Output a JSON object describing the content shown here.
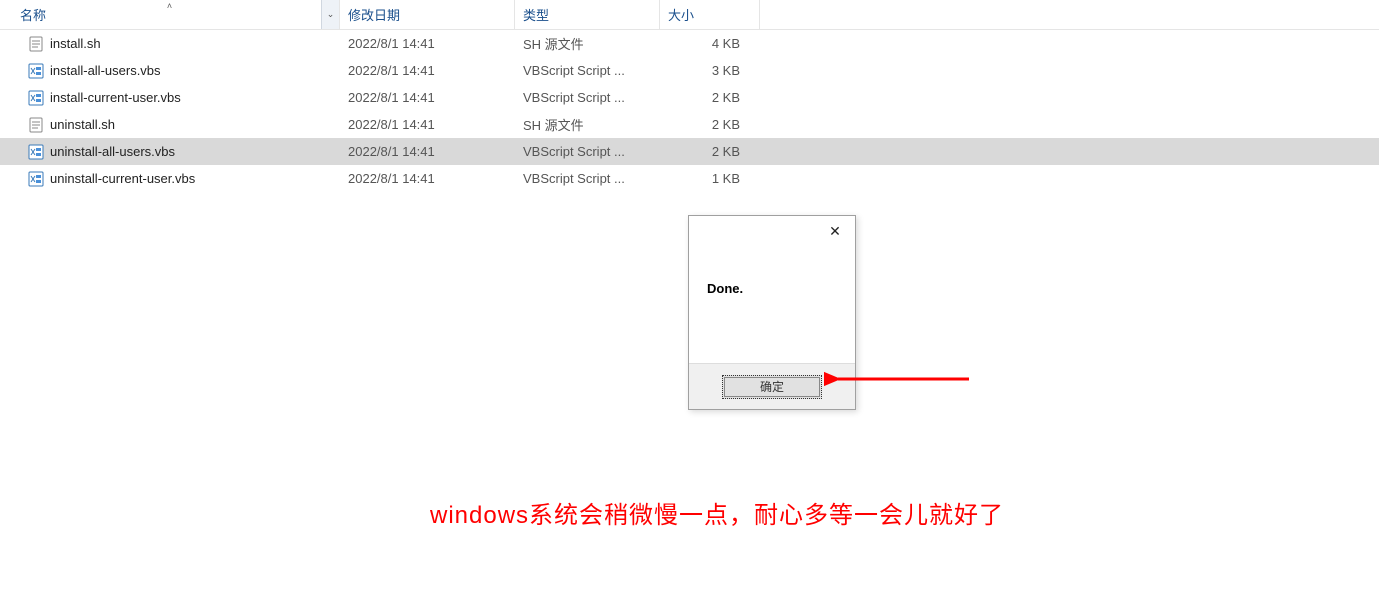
{
  "columns": {
    "name": "名称",
    "date": "修改日期",
    "type": "类型",
    "size": "大小"
  },
  "files": [
    {
      "name": "install.sh",
      "date": "2022/8/1 14:41",
      "type": "SH 源文件",
      "size": "4 KB",
      "icon": "sh",
      "selected": false
    },
    {
      "name": "install-all-users.vbs",
      "date": "2022/8/1 14:41",
      "type": "VBScript Script ...",
      "size": "3 KB",
      "icon": "vbs",
      "selected": false
    },
    {
      "name": "install-current-user.vbs",
      "date": "2022/8/1 14:41",
      "type": "VBScript Script ...",
      "size": "2 KB",
      "icon": "vbs",
      "selected": false
    },
    {
      "name": "uninstall.sh",
      "date": "2022/8/1 14:41",
      "type": "SH 源文件",
      "size": "2 KB",
      "icon": "sh",
      "selected": false
    },
    {
      "name": "uninstall-all-users.vbs",
      "date": "2022/8/1 14:41",
      "type": "VBScript Script ...",
      "size": "2 KB",
      "icon": "vbs",
      "selected": true
    },
    {
      "name": "uninstall-current-user.vbs",
      "date": "2022/8/1 14:41",
      "type": "VBScript Script ...",
      "size": "1 KB",
      "icon": "vbs",
      "selected": false
    }
  ],
  "dialog": {
    "message": "Done.",
    "ok_label": "确定"
  },
  "caption": "windows系统会稍微慢一点，耐心多等一会儿就好了",
  "icons": {
    "sort_asc": "˄",
    "dropdown": "⌄",
    "close": "✕"
  }
}
